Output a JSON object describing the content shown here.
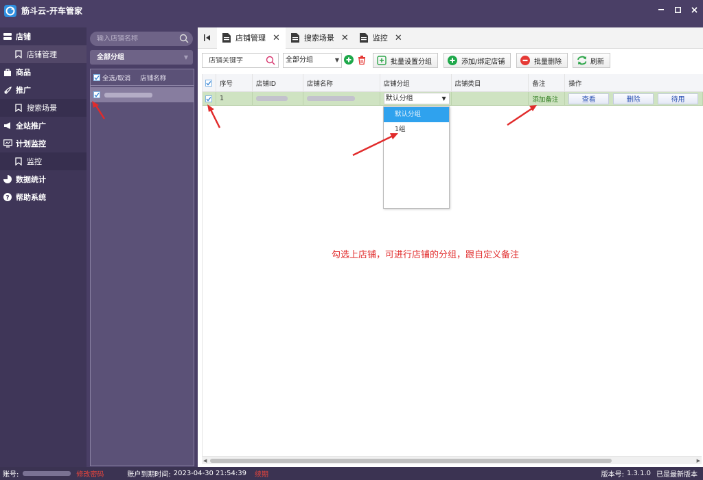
{
  "window": {
    "title": "筋斗云-开车管家",
    "controls": [
      "minimize",
      "maximize",
      "close"
    ]
  },
  "nav": {
    "items": [
      {
        "label": "店铺",
        "icon": "store-icon",
        "level": "top"
      },
      {
        "label": "店铺管理",
        "icon": "bookmark-icon",
        "level": "sub",
        "active": true
      },
      {
        "label": "商品",
        "icon": "bag-icon",
        "level": "top"
      },
      {
        "label": "推广",
        "icon": "rocket-icon",
        "level": "top"
      },
      {
        "label": "搜索场景",
        "icon": "bookmark-icon",
        "level": "sub",
        "active": false
      },
      {
        "label": "全站推广",
        "icon": "megaphone-icon",
        "level": "top"
      },
      {
        "label": "计划监控",
        "icon": "monitor-icon",
        "level": "top"
      },
      {
        "label": "监控",
        "icon": "bookmark-icon",
        "level": "sub",
        "active": false
      },
      {
        "label": "数据统计",
        "icon": "pie-chart-icon",
        "level": "top"
      },
      {
        "label": "帮助系统",
        "icon": "help-icon",
        "level": "top"
      }
    ]
  },
  "store_panel": {
    "search_placeholder": "输入店铺名称",
    "group_select": "全部分组",
    "header_select_all": "全选/取消",
    "header_name": "店铺名称"
  },
  "tabs": [
    {
      "label": "店铺管理",
      "active": true
    },
    {
      "label": "搜索场景",
      "active": false
    },
    {
      "label": "监控",
      "active": false
    }
  ],
  "toolbar": {
    "keyword_placeholder": "店铺关键字",
    "group_filter": "全部分组",
    "batch_group_label": "批量设置分组",
    "add_bind_label": "添加/绑定店铺",
    "batch_delete_label": "批量删除",
    "refresh_label": "刷新"
  },
  "table": {
    "columns": [
      "序号",
      "店铺ID",
      "店铺名称",
      "店铺分组",
      "店铺类目",
      "备注",
      "操作"
    ],
    "rows": [
      {
        "index": "1",
        "group": "默认分组",
        "category": "",
        "note_link": "添加备注",
        "actions": [
          "查看",
          "删除",
          "待用"
        ]
      }
    ]
  },
  "group_dropdown": {
    "options": [
      "默认分组",
      "1组"
    ],
    "selected": "默认分组"
  },
  "annotation": "勾选上店铺，可进行店铺的分组，跟自定义备注",
  "status": {
    "account_label": "账号:",
    "change_password": "修改密码",
    "expiry_label": "账户到期时间:",
    "expiry_value": "2023-04-30 21:54:39",
    "renew": "续期",
    "version_label": "版本号:",
    "version_value": "1.3.1.0",
    "version_note": "已是最新版本"
  },
  "colors": {
    "sidebar_bg": "#3f3658",
    "selected_row": "#cfe3c2",
    "dropdown_selected": "#2fa2ee",
    "annotation_red": "#e12b2b",
    "link_green": "#2a7a1a"
  }
}
